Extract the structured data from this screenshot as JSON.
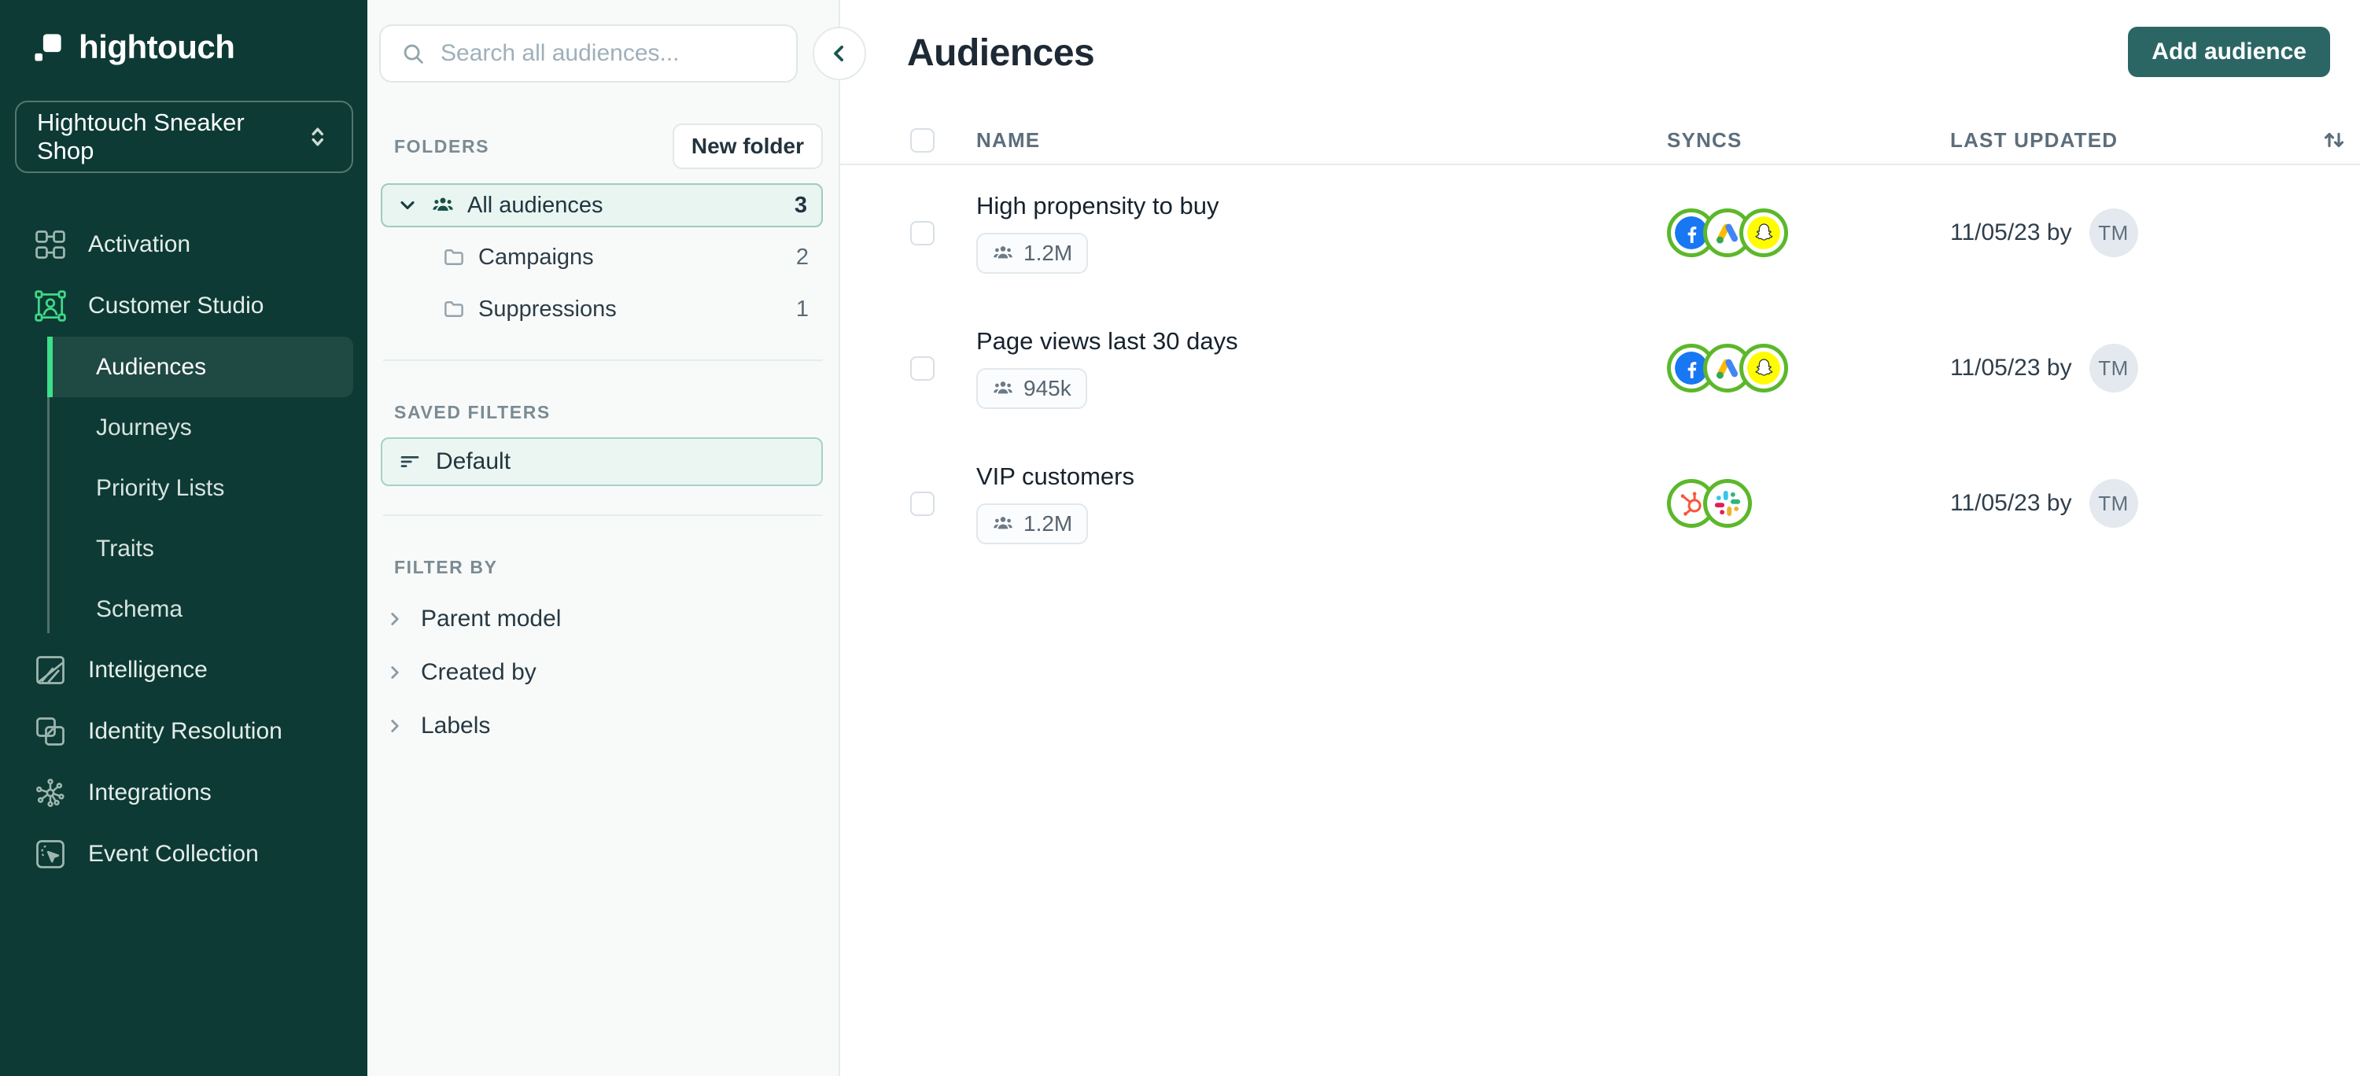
{
  "sidebar": {
    "logo": "hightouch",
    "workspace": "Hightouch Sneaker Shop",
    "nav": {
      "activation": "Activation",
      "customer_studio": "Customer Studio",
      "intelligence": "Intelligence",
      "identity_resolution": "Identity Resolution",
      "integrations": "Integrations",
      "event_collection": "Event Collection"
    },
    "subnav": [
      "Audiences",
      "Journeys",
      "Priority Lists",
      "Traits",
      "Schema"
    ],
    "active_subnav": "Audiences"
  },
  "panel": {
    "search_placeholder": "Search all audiences...",
    "folders_label": "FOLDERS",
    "new_folder_button": "New folder",
    "tree": [
      {
        "name": "All audiences",
        "count": "3",
        "icon": "audience-people-icon",
        "selected": true
      },
      {
        "name": "Campaigns",
        "count": "2",
        "icon": "folder-icon"
      },
      {
        "name": "Suppressions",
        "count": "1",
        "icon": "folder-icon"
      }
    ],
    "saved_filters_label": "SAVED FILTERS",
    "saved_filters": [
      {
        "name": "Default",
        "icon": "filter-lines-icon"
      }
    ],
    "filter_by_label": "FILTER BY",
    "filters": [
      "Parent model",
      "Created by",
      "Labels"
    ]
  },
  "main": {
    "title": "Audiences",
    "add_button": "Add audience",
    "columns": {
      "name": "NAME",
      "syncs": "SYNCS",
      "last_updated": "LAST UPDATED"
    },
    "rows": [
      {
        "name": "High propensity to buy",
        "size": "1.2M",
        "syncs": [
          "facebook-icon",
          "google-ads-icon",
          "snapchat-icon"
        ],
        "updated": "11/05/23 by",
        "avatar": "TM"
      },
      {
        "name": "Page views last 30 days",
        "size": "945k",
        "syncs": [
          "facebook-icon",
          "google-ads-icon",
          "snapchat-icon"
        ],
        "updated": "11/05/23 by",
        "avatar": "TM"
      },
      {
        "name": "VIP customers",
        "size": "1.2M",
        "syncs": [
          "hubspot-icon",
          "slack-icon"
        ],
        "updated": "11/05/23 by",
        "avatar": "TM"
      }
    ]
  },
  "colors": {
    "sidebar_bg": "#0d3a34",
    "accent_green": "#3ce08b",
    "customer_studio_icon_green": "#3fd888",
    "button_teal": "#2b6664",
    "sync_ring_green": "#5cb82a",
    "facebook_blue": "#1877f2",
    "snapchat_yellow": "#fffc00",
    "hubspot_orange": "#f8573b",
    "google_ads": [
      "#fbbc04",
      "#4285f4",
      "#34a853"
    ],
    "slack": [
      "#36c5f0",
      "#2eb67d",
      "#ecb22e",
      "#e01e5a"
    ],
    "selected_folder_bg": "#e8f5f1",
    "panel_bg": "#f8fafa"
  }
}
